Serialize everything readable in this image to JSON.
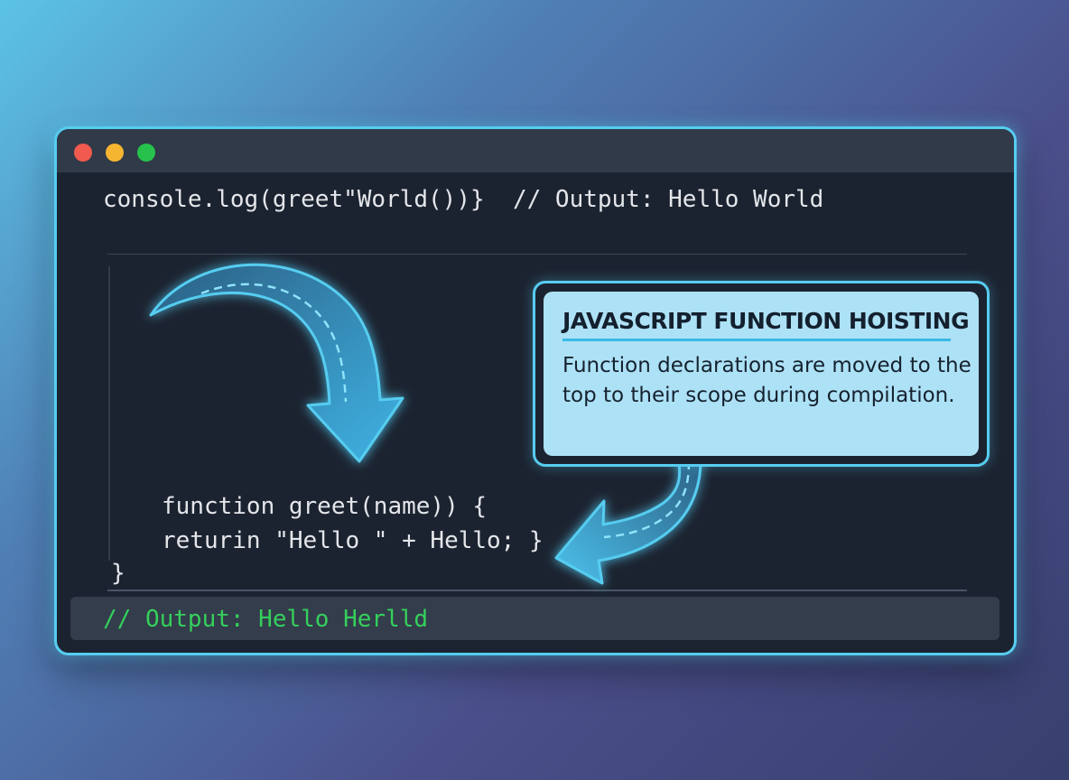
{
  "window": {
    "controls": [
      "close",
      "minimize",
      "maximize"
    ],
    "top_line": {
      "code": "console.log(greet\"World())}",
      "comment": "// Output: Hello World"
    },
    "code_lines": [
      "function greet(name)) {",
      "returin \"Hello \" + Hello; }",
      "}"
    ],
    "output_bar": "// Output: Hello Herlld"
  },
  "callout": {
    "title": "JAVASCRIPT FUNCTION HOISTING",
    "body": "Function declarations are moved to the top to their scope during compilation."
  },
  "colors": {
    "frame_border": "#56cdf0",
    "editor_background": "#1c2330",
    "output_text": "#35d05c",
    "callout_background": "#ade1f6"
  },
  "icons": [
    "curved-arrow-down-icon",
    "curved-arrow-left-icon"
  ]
}
